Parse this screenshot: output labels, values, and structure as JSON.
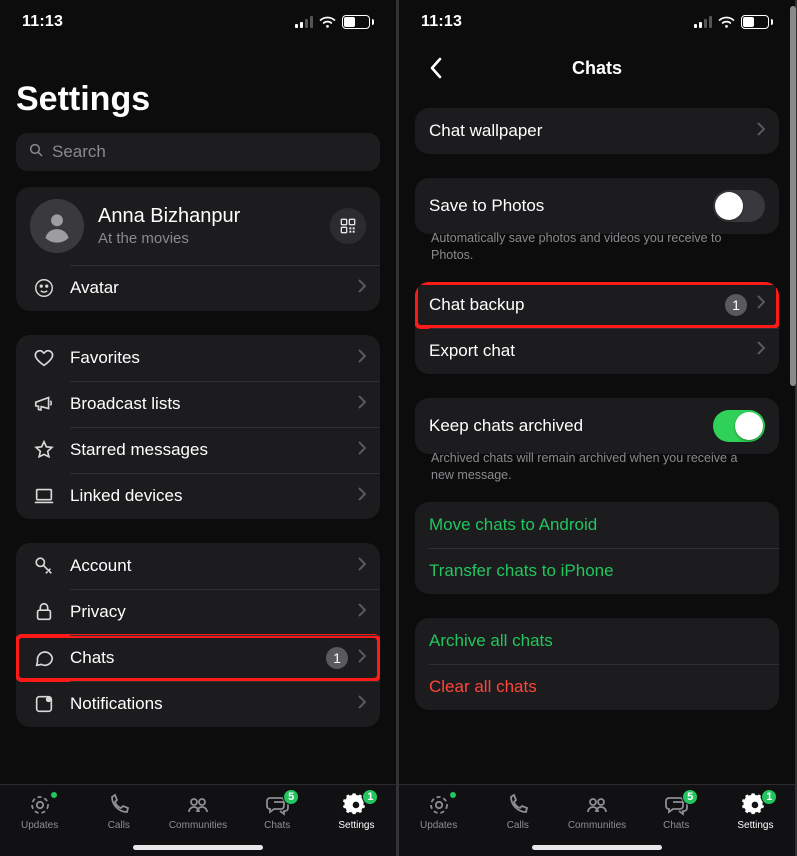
{
  "status": {
    "time": "11:13",
    "battery_pct": 44,
    "signal_bars_active": 2
  },
  "left": {
    "title": "Settings",
    "search_placeholder": "Search",
    "profile": {
      "name": "Anna Bizhanpur",
      "status": "At the movies",
      "avatar_label": "Avatar"
    },
    "group_favs": {
      "favorites": "Favorites",
      "broadcast": "Broadcast lists",
      "starred": "Starred messages",
      "linked": "Linked devices"
    },
    "group_acct": {
      "account": "Account",
      "privacy": "Privacy",
      "chats": "Chats",
      "chats_badge": "1",
      "notifications": "Notifications"
    }
  },
  "right": {
    "header": "Chats",
    "wallpaper": "Chat wallpaper",
    "save_photos": "Save to Photos",
    "save_photos_footer": "Automatically save photos and videos you receive to Photos.",
    "chat_backup": "Chat backup",
    "chat_backup_badge": "1",
    "export_chat": "Export chat",
    "keep_archived": "Keep chats archived",
    "keep_archived_footer": "Archived chats will remain archived when you receive a new message.",
    "move_android": "Move chats to Android",
    "transfer_iphone": "Transfer chats to iPhone",
    "archive_all": "Archive all chats",
    "clear_all": "Clear all chats"
  },
  "tabs": {
    "updates": "Updates",
    "calls": "Calls",
    "communities": "Communities",
    "chats": "Chats",
    "chats_badge": "5",
    "settings": "Settings",
    "settings_badge": "1"
  }
}
